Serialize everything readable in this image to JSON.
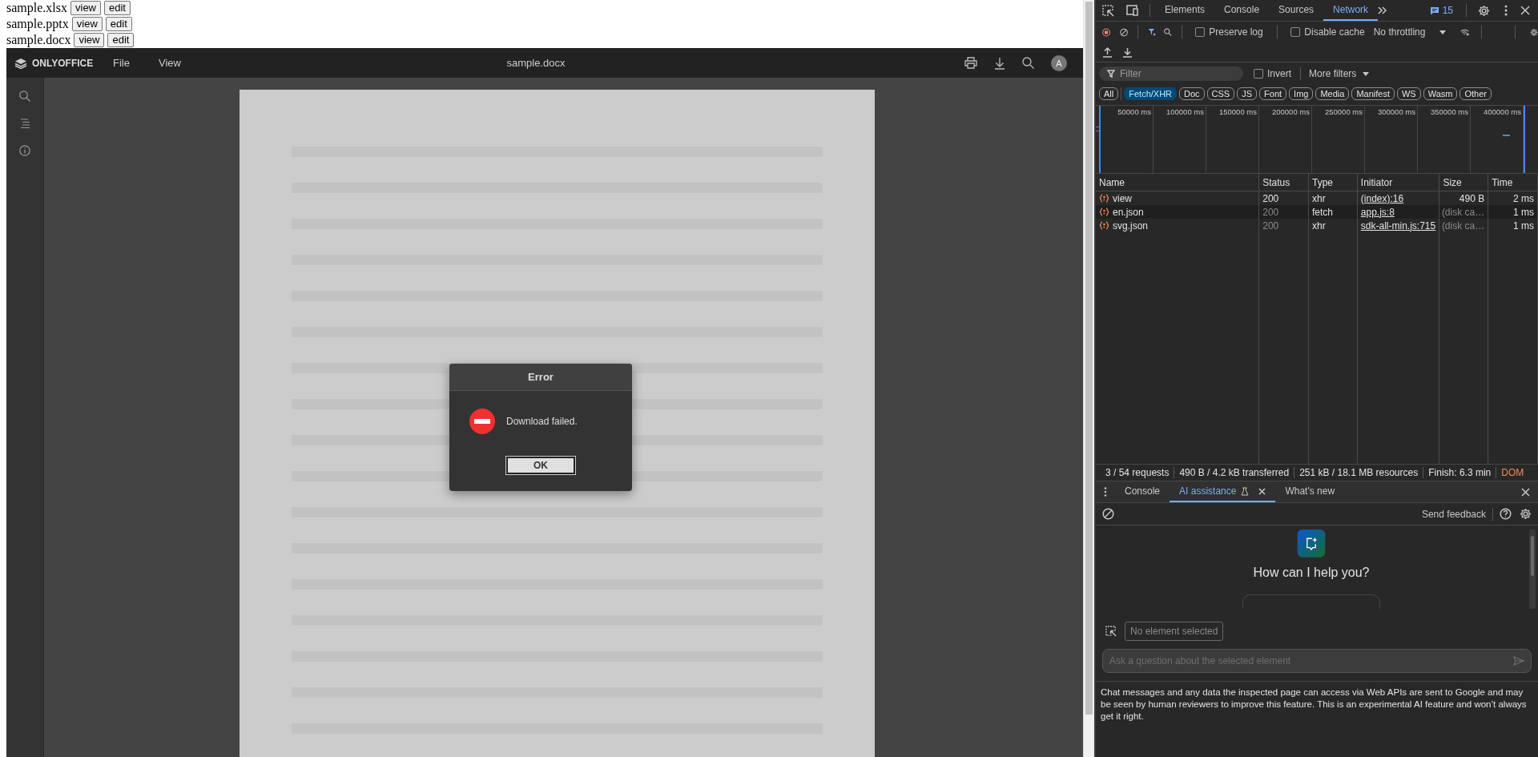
{
  "file_list": [
    {
      "name": "sample.xlsx",
      "buttons": [
        "view",
        "edit"
      ]
    },
    {
      "name": "sample.pptx",
      "buttons": [
        "view",
        "edit"
      ]
    },
    {
      "name": "sample.docx",
      "buttons": [
        "view",
        "edit"
      ]
    }
  ],
  "editor": {
    "logo": "ONLYOFFICE",
    "menu": [
      "File",
      "View"
    ],
    "title": "sample.docx",
    "avatar": "A"
  },
  "dialog": {
    "title": "Error",
    "message": "Download failed.",
    "button": "OK"
  },
  "devtools": {
    "tabs": [
      {
        "label": "Elements",
        "selected": false
      },
      {
        "label": "Console",
        "selected": false
      },
      {
        "label": "Sources",
        "selected": false
      },
      {
        "label": "Network",
        "selected": true
      }
    ],
    "issues_count": "15",
    "preserve_log": {
      "label": "Preserve log",
      "checked": false
    },
    "disable_cache": {
      "label": "Disable cache",
      "checked": false
    },
    "throttling": "No throttling",
    "filter": {
      "placeholder": "Filter"
    },
    "invert": {
      "label": "Invert",
      "checked": false
    },
    "more_filters": "More filters",
    "type_filters": [
      {
        "label": "All",
        "selected": false
      },
      {
        "label": "Fetch/XHR",
        "selected": true
      },
      {
        "label": "Doc",
        "selected": false
      },
      {
        "label": "CSS",
        "selected": false
      },
      {
        "label": "JS",
        "selected": false
      },
      {
        "label": "Font",
        "selected": false
      },
      {
        "label": "Img",
        "selected": false
      },
      {
        "label": "Media",
        "selected": false
      },
      {
        "label": "Manifest",
        "selected": false
      },
      {
        "label": "WS",
        "selected": false
      },
      {
        "label": "Wasm",
        "selected": false
      },
      {
        "label": "Other",
        "selected": false
      }
    ],
    "timeline_ticks": [
      "50000 ms",
      "100000 ms",
      "150000 ms",
      "200000 ms",
      "250000 ms",
      "300000 ms",
      "350000 ms",
      "400000 ms"
    ],
    "columns": [
      "Name",
      "Status",
      "Type",
      "Initiator",
      "Size",
      "Time"
    ],
    "rows": [
      {
        "name": "view",
        "status": "200",
        "type": "xhr",
        "initiator": "(index):16",
        "size": "490 B",
        "time": "2 ms",
        "from_cache": false
      },
      {
        "name": "en.json",
        "status": "200",
        "type": "fetch",
        "initiator": "app.js:8",
        "size": "(disk ca…",
        "time": "1 ms",
        "from_cache": true
      },
      {
        "name": "svg.json",
        "status": "200",
        "type": "xhr",
        "initiator": "sdk-all-min.js:715",
        "size": "(disk ca…",
        "time": "1 ms",
        "from_cache": true
      }
    ],
    "summary": [
      {
        "text": "3 / 54 requests",
        "kind": "count"
      },
      {
        "text": "490 B / 4.2 kB transferred",
        "kind": "count"
      },
      {
        "text": "251 kB / 18.1 MB resources",
        "kind": "count"
      },
      {
        "text": "Finish: 6.3 min",
        "kind": "count"
      },
      {
        "text": "DOM",
        "kind": "event"
      }
    ],
    "drawer": {
      "tabs": [
        {
          "label": "Console",
          "selected": false,
          "closable": false
        },
        {
          "label": "AI assistance",
          "selected": true,
          "closable": true
        },
        {
          "label": "What's new",
          "selected": false,
          "closable": false
        }
      ],
      "send_feedback": "Send feedback",
      "heading": "How can I help you?",
      "context": "No element selected",
      "input": {
        "placeholder": "Ask a question about the selected element"
      },
      "disclaimer": "Chat messages and any data the inspected page can access via Web APIs are sent to Google and may be seen by human reviewers to improve this feature. This is an experimental AI feature and won’t always get it right."
    }
  }
}
